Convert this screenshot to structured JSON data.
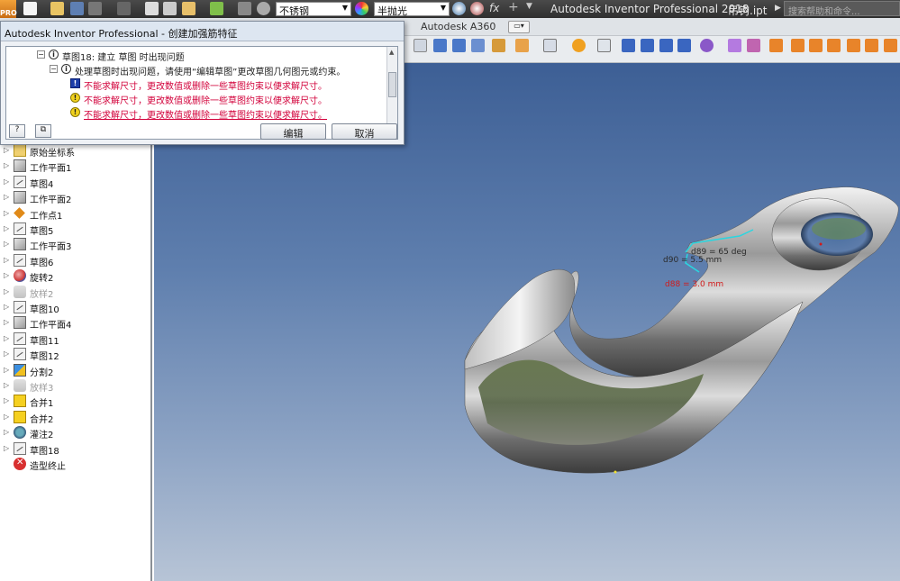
{
  "titlebar": {
    "app_title": "Autodesk Inventor Professional 2018",
    "file_name": "吊钩.ipt",
    "material_select": "不锈钢",
    "appearance_select": "半抛光",
    "help_search_placeholder": "搜索帮助和命令...",
    "icons": [
      "new-icon",
      "open-icon",
      "save-icon",
      "undo-icon",
      "redo-icon",
      "home-icon",
      "print-icon",
      "sketch-icon",
      "update-icon",
      "project-icon",
      "material-icon",
      "appearance-icon",
      "adjust-icon",
      "clear-icon",
      "fx-icon",
      "add-icon",
      "more-icon"
    ]
  },
  "ribbon": {
    "tabs": {
      "a360": "Autodesk A360"
    }
  },
  "dialog": {
    "title": "Autodesk Inventor Professional - 创建加强筋特征",
    "root": "草图18: 建立 草图 时出现问题",
    "child": "处理草图时出现问题，请使用“编辑草图”更改草图几何图元或约束。",
    "errors": [
      "不能求解尺寸，更改数值或删除一些草图约束以便求解尺寸。",
      "不能求解尺寸，更改数值或删除一些草图约束以便求解尺寸。",
      "不能求解尺寸，更改数值或删除一些草图约束以便求解尺寸。"
    ],
    "edit_button": "编辑",
    "cancel_button": "取消"
  },
  "browser": {
    "nodes": [
      {
        "label": "原始坐标系",
        "icon": "folder-icon",
        "dim": false
      },
      {
        "label": "工作平面1",
        "icon": "work-plane-icon",
        "dim": false
      },
      {
        "label": "草图4",
        "icon": "sketch-icon",
        "dim": false
      },
      {
        "label": "工作平面2",
        "icon": "work-plane-icon",
        "dim": false
      },
      {
        "label": "工作点1",
        "icon": "work-point-icon",
        "dim": false
      },
      {
        "label": "草图5",
        "icon": "sketch-icon",
        "dim": false
      },
      {
        "label": "工作平面3",
        "icon": "work-plane-icon",
        "dim": false
      },
      {
        "label": "草图6",
        "icon": "sketch-icon",
        "dim": false
      },
      {
        "label": "旋转2",
        "icon": "revolve-icon",
        "dim": false
      },
      {
        "label": "放样2",
        "icon": "loft-icon",
        "dim": true
      },
      {
        "label": "草图10",
        "icon": "sketch-icon",
        "dim": false
      },
      {
        "label": "工作平面4",
        "icon": "work-plane-icon",
        "dim": false
      },
      {
        "label": "草图11",
        "icon": "sketch-icon",
        "dim": false
      },
      {
        "label": "草图12",
        "icon": "sketch-icon",
        "dim": false
      },
      {
        "label": "分割2",
        "icon": "split-icon",
        "dim": false
      },
      {
        "label": "放样3",
        "icon": "loft-icon",
        "dim": true
      },
      {
        "label": "合并1",
        "icon": "combine-icon",
        "dim": false
      },
      {
        "label": "合并2",
        "icon": "combine-icon",
        "dim": false
      },
      {
        "label": "灌注2",
        "icon": "shell-icon",
        "dim": false
      },
      {
        "label": "草图18",
        "icon": "sketch-icon",
        "dim": false
      },
      {
        "label": "造型终止",
        "icon": "end-of-part-icon",
        "dim": false
      }
    ]
  },
  "viewport": {
    "dimensions": {
      "d89": "d89 = 65 deg",
      "d90": "d90 = 5.5 mm",
      "d88": "d88 = 3.0 mm"
    },
    "colors": {
      "d89": "#2a2a2a",
      "d90": "#2a2a2a",
      "d88": "#d21a1a"
    }
  }
}
